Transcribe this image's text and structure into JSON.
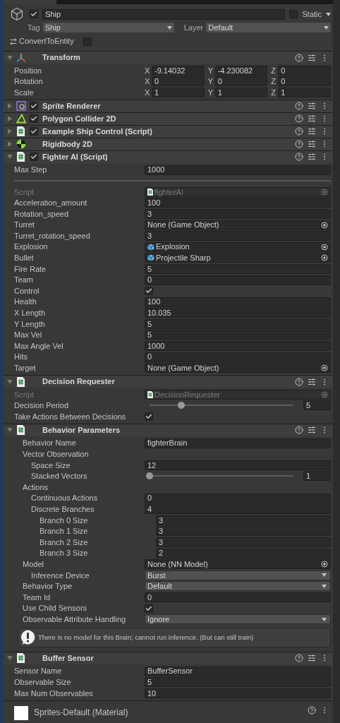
{
  "object": {
    "enabled": true,
    "name": "Ship",
    "static": false,
    "static_label": "Static",
    "tag_label": "Tag",
    "tag": "Ship",
    "layer_label": "Layer",
    "layer": "Default",
    "convert_label": "ConvertToEntity",
    "convert": false
  },
  "components": [
    {
      "title": "Transform",
      "kind": "transform",
      "expanded": true,
      "fields": [
        {
          "kind": "vector3",
          "label": "Position",
          "axes": [
            {
              "axis": "X",
              "value": "-9.14032"
            },
            {
              "axis": "Y",
              "value": "-4.230082"
            },
            {
              "axis": "Z",
              "value": "0"
            }
          ]
        },
        {
          "kind": "vector3",
          "label": "Rotation",
          "axes": [
            {
              "axis": "X",
              "value": "0"
            },
            {
              "axis": "Y",
              "value": "0"
            },
            {
              "axis": "Z",
              "value": "0"
            }
          ]
        },
        {
          "kind": "vector3",
          "label": "Scale",
          "axes": [
            {
              "axis": "X",
              "value": "1"
            },
            {
              "axis": "Y",
              "value": "1"
            },
            {
              "axis": "Z",
              "value": "1"
            }
          ]
        }
      ]
    },
    {
      "title": "Sprite Renderer",
      "kind": "sprite",
      "enabled": true,
      "expanded": false
    },
    {
      "title": "Polygon Collider 2D",
      "kind": "polygon",
      "enabled": true,
      "expanded": false
    },
    {
      "title": "Example Ship Control (Script)",
      "kind": "script",
      "enabled": true,
      "expanded": false
    },
    {
      "title": "Rigidbody 2D",
      "kind": "rigidbody",
      "expanded": false
    },
    {
      "title": "Fighter AI (Script)",
      "kind": "script",
      "enabled": true,
      "expanded": true,
      "fields": [
        {
          "kind": "text",
          "label": "Max Step",
          "value": "1000"
        },
        {
          "kind": "separator"
        },
        {
          "kind": "script_object",
          "label": "Script",
          "value": "fighterAI",
          "disabled": true
        },
        {
          "kind": "text",
          "label": "Acceleration_amount",
          "value": "100"
        },
        {
          "kind": "text",
          "label": "Rotation_speed",
          "value": "3"
        },
        {
          "kind": "object",
          "label": "Turret",
          "value": "None (Game Object)",
          "disabled": false
        },
        {
          "kind": "text",
          "label": "Turret_rotation_speed",
          "value": "3"
        },
        {
          "kind": "prefab_object",
          "label": "Explosion",
          "value": "Explosion",
          "disabled": false
        },
        {
          "kind": "prefab_object",
          "label": "Bullet",
          "value": "Projectile Sharp",
          "disabled": false
        },
        {
          "kind": "text",
          "label": "Fire Rate",
          "value": "5"
        },
        {
          "kind": "text",
          "label": "Team",
          "value": "0"
        },
        {
          "kind": "checkbox",
          "label": "Control",
          "checked": true
        },
        {
          "kind": "text",
          "label": "Health",
          "value": "100"
        },
        {
          "kind": "text",
          "label": "X Length",
          "value": "10.035"
        },
        {
          "kind": "text",
          "label": "Y Length",
          "value": "5"
        },
        {
          "kind": "text",
          "label": "Max Vel",
          "value": "5"
        },
        {
          "kind": "text",
          "label": "Max Angle Vel",
          "value": "1000"
        },
        {
          "kind": "text",
          "label": "Hits",
          "value": "0"
        },
        {
          "kind": "object",
          "label": "Target",
          "value": "None (Game Object)",
          "disabled": false
        }
      ]
    },
    {
      "title": "Decision Requester",
      "kind": "script",
      "expanded": true,
      "fields": [
        {
          "kind": "script_object",
          "label": "Script",
          "value": "DecisionRequester",
          "disabled": true
        },
        {
          "kind": "slider",
          "label": "Decision Period",
          "level": 0.22,
          "value": "5"
        },
        {
          "kind": "checkbox",
          "label": "Take Actions Between Decisions",
          "checked": true
        }
      ]
    },
    {
      "title": "Behavior Parameters",
      "kind": "script",
      "expanded": true,
      "indented": true,
      "fields": [
        {
          "kind": "text",
          "label": "Behavior Name",
          "value": "fighterBrain"
        },
        {
          "kind": "group",
          "label": "Vector Observation",
          "children": [
            {
              "kind": "text",
              "label": "Space Size",
              "value": "12"
            },
            {
              "kind": "slider",
              "label": "Stacked Vectors",
              "level": 0,
              "value": "1"
            }
          ]
        },
        {
          "kind": "group",
          "label": "Actions",
          "children": [
            {
              "kind": "text",
              "label": "Continuous Actions",
              "value": "0"
            },
            {
              "kind": "text",
              "label": "Discrete Branches",
              "value": "4",
              "children": [
                {
                  "kind": "text",
                  "label": "Branch 0 Size",
                  "value": "3"
                },
                {
                  "kind": "text",
                  "label": "Branch 1 Size",
                  "value": "3"
                },
                {
                  "kind": "text",
                  "label": "Branch 2 Size",
                  "value": "3"
                },
                {
                  "kind": "text",
                  "label": "Branch 3 Size",
                  "value": "2"
                }
              ]
            }
          ]
        },
        {
          "kind": "object",
          "label": "Model",
          "value": "None (NN Model)",
          "disabled": false,
          "children": [
            {
              "kind": "dropdown",
              "label": "Inference Device",
              "value": "Burst"
            }
          ]
        },
        {
          "kind": "dropdown",
          "label": "Behavior Type",
          "value": "Default"
        },
        {
          "kind": "text",
          "label": "Team Id",
          "value": "0"
        },
        {
          "kind": "checkbox",
          "label": "Use Child Sensors",
          "checked": true
        },
        {
          "kind": "dropdown",
          "label": "Observable Attribute Handling",
          "value": "Ignore"
        },
        {
          "kind": "help",
          "text": "There is no model for this Brain; cannot run inference. (But can still train)"
        }
      ]
    },
    {
      "title": "Buffer Sensor",
      "kind": "script",
      "expanded": true,
      "fields": [
        {
          "kind": "text",
          "label": "Sensor Name",
          "value": "BufferSensor"
        },
        {
          "kind": "text",
          "label": "Observable Size",
          "value": "5"
        },
        {
          "kind": "text",
          "label": "Max Num Observables",
          "value": "10"
        }
      ]
    }
  ],
  "material": {
    "name": "Sprites-Default (Material)"
  }
}
